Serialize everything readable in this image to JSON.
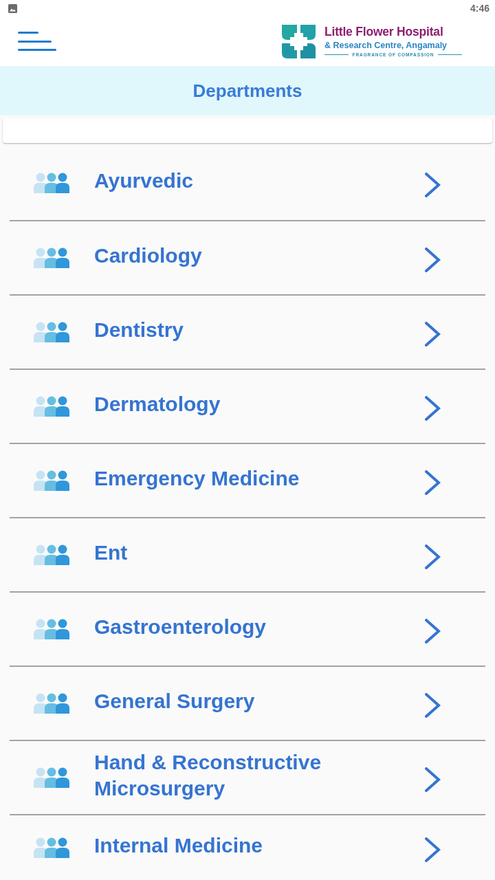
{
  "status_bar": {
    "time": "4:46"
  },
  "header": {
    "logo": {
      "name": "Little Flower Hospital",
      "subtitle": "& Research Centre, Angamaly",
      "tagline": "FRAGRANCE OF COMPASSION"
    }
  },
  "title": "Departments",
  "departments": [
    "Ayurvedic",
    "Cardiology",
    "Dentistry",
    "Dermatology",
    "Emergency Medicine",
    "Ent",
    "Gastroenterology",
    "General Surgery",
    "Hand & Reconstructive Microsurgery",
    "Internal Medicine"
  ]
}
